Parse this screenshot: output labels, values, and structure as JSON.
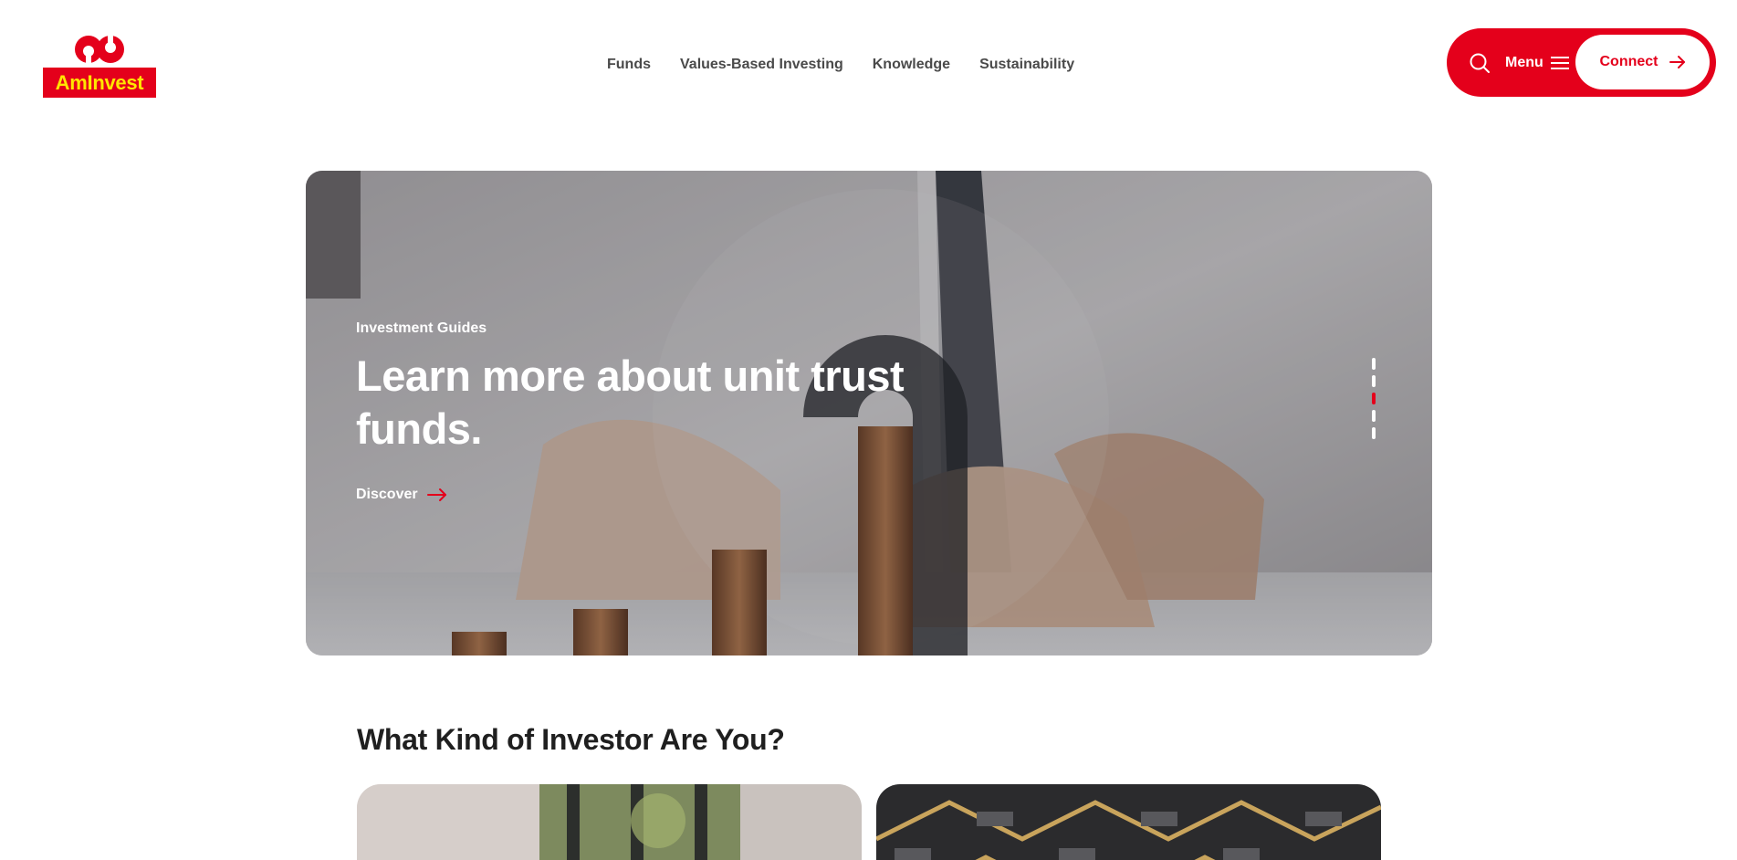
{
  "brand": {
    "name": "AmInvest",
    "primary": "#e4001b",
    "logo_text_color": "#ffe600"
  },
  "nav": {
    "items": [
      {
        "label": "Funds"
      },
      {
        "label": "Values-Based Investing"
      },
      {
        "label": "Knowledge"
      },
      {
        "label": "Sustainability"
      }
    ]
  },
  "header": {
    "search_icon": "search-icon",
    "menu_label": "Menu",
    "menu_icon": "hamburger-icon",
    "connect_label": "Connect",
    "connect_icon": "arrow-right-icon"
  },
  "hero": {
    "eyebrow": "Investment Guides",
    "title": "Learn more about unit trust funds.",
    "cta_label": "Discover",
    "cta_icon": "arrow-right-icon",
    "slides_total": 5,
    "active_slide": 3
  },
  "section": {
    "title": "What Kind of Investor Are You?"
  }
}
